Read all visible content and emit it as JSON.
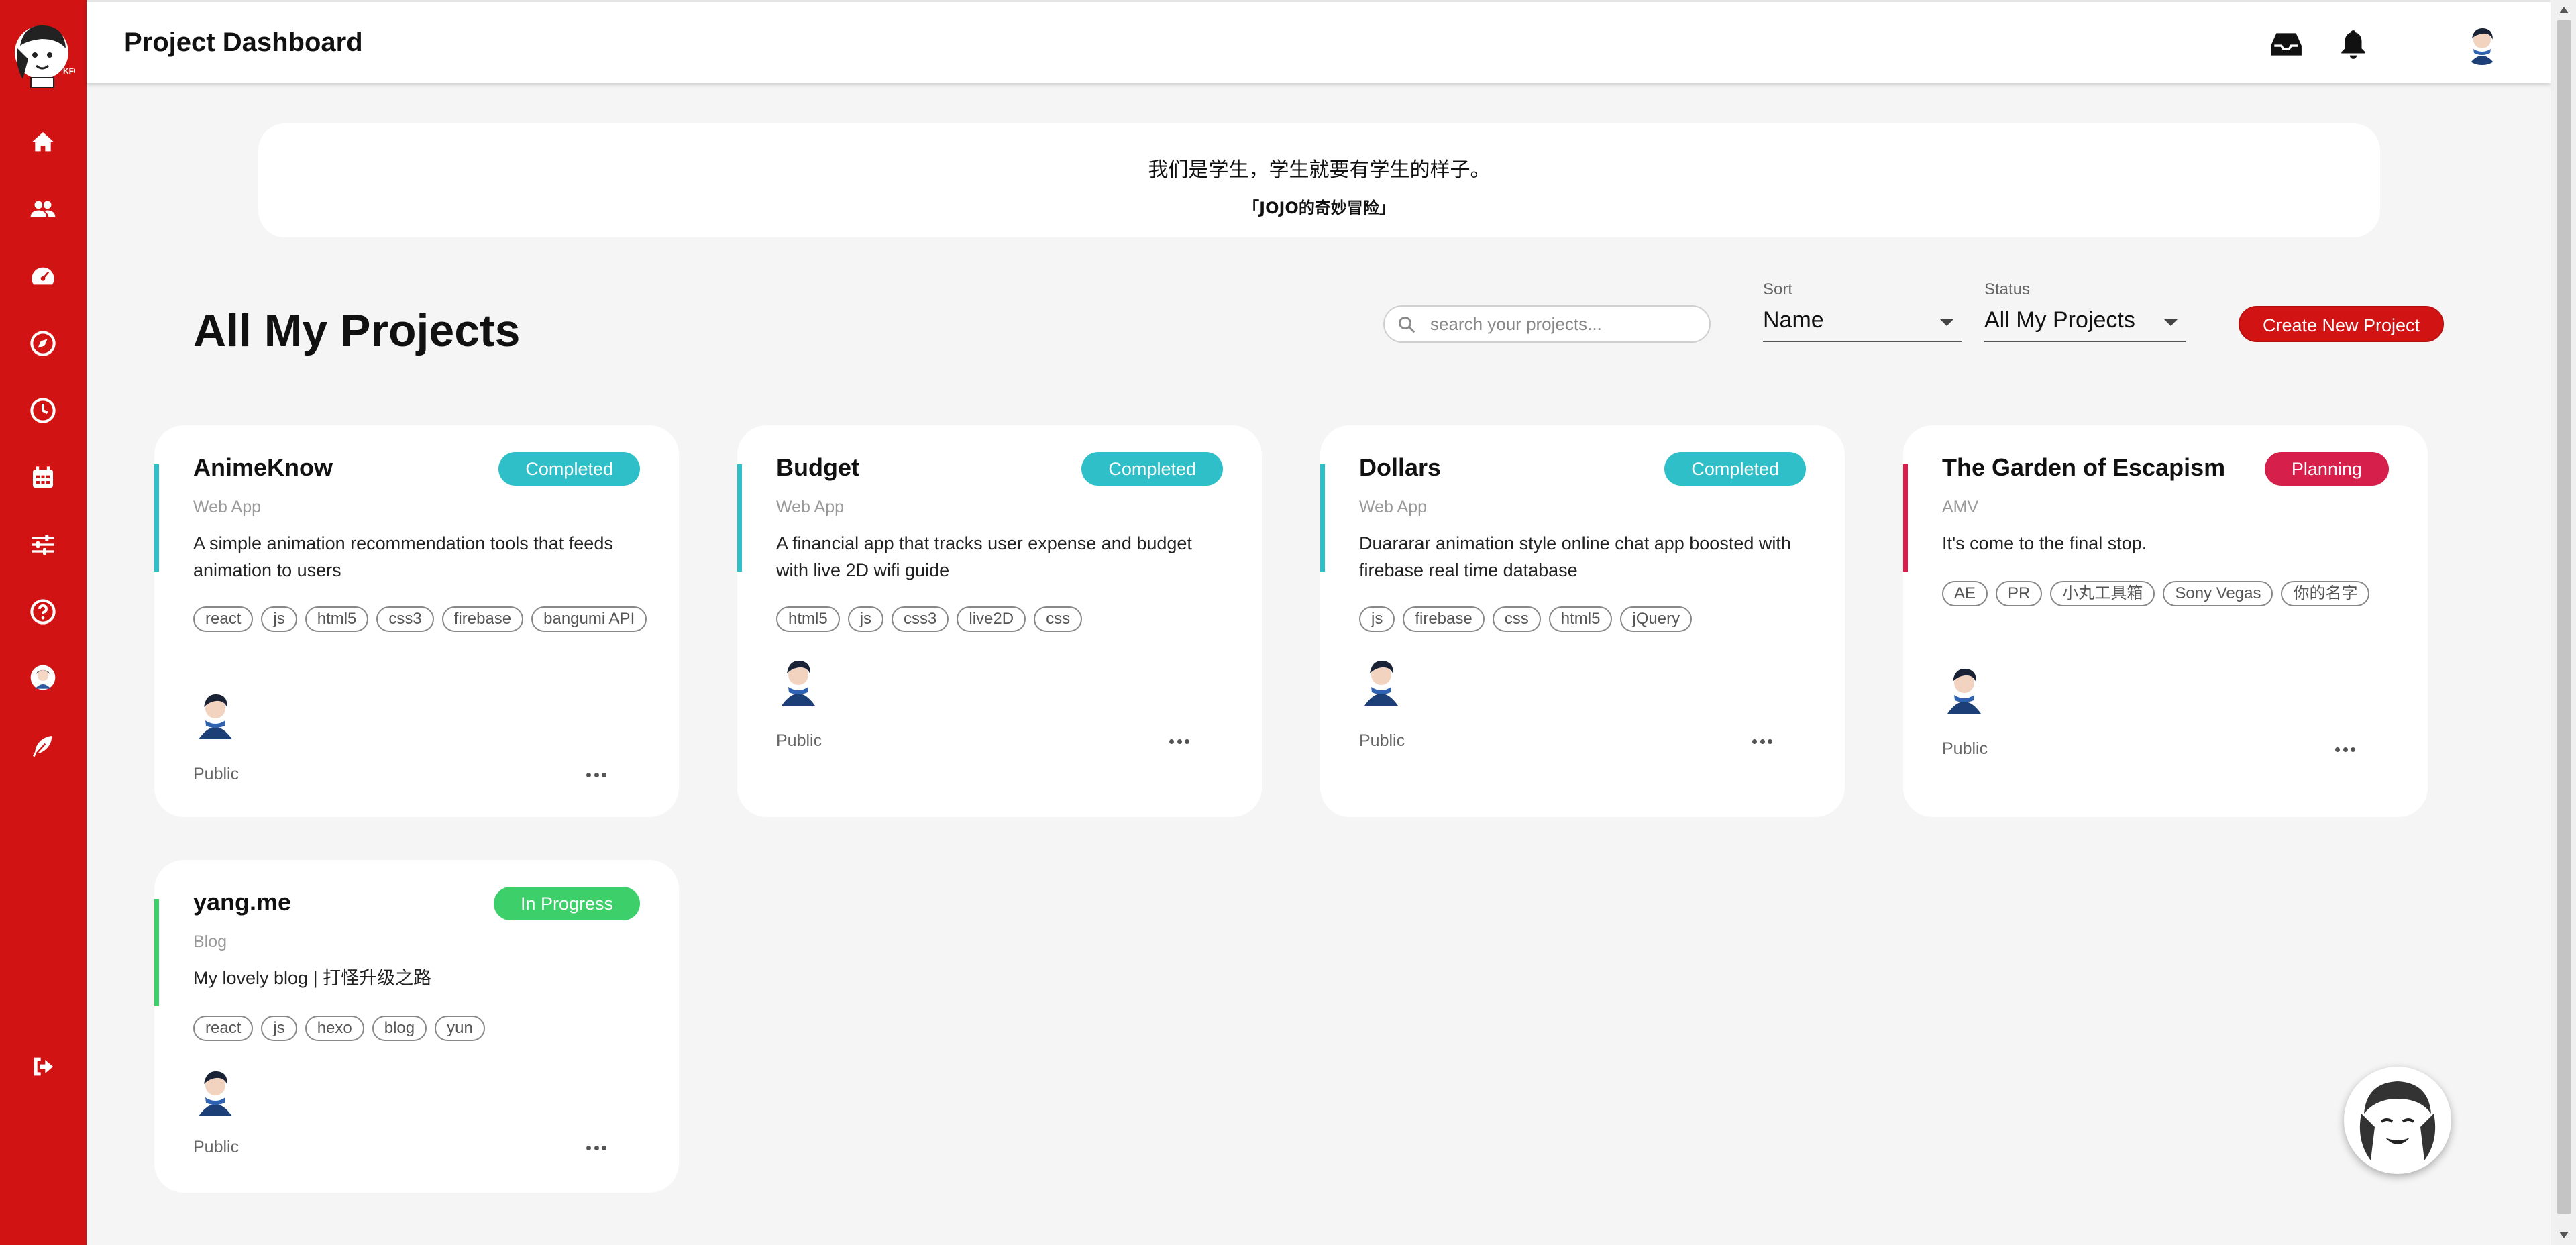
{
  "header": {
    "title": "Project Dashboard",
    "icons": [
      "inbox-icon",
      "bell-icon",
      "user-avatar"
    ]
  },
  "sidebar": {
    "items": [
      {
        "name": "home-icon"
      },
      {
        "name": "users-icon"
      },
      {
        "name": "dashboard-icon"
      },
      {
        "name": "compass-icon"
      },
      {
        "name": "clock-icon"
      },
      {
        "name": "calendar-icon"
      },
      {
        "name": "sliders-icon"
      },
      {
        "name": "help-icon"
      },
      {
        "name": "avatar-icon"
      },
      {
        "name": "feather-icon"
      },
      {
        "name": "logout-icon"
      }
    ]
  },
  "quote": {
    "text": "我们是学生，学生就要有学生的样子。",
    "source": "「JOJO的奇妙冒险」"
  },
  "main": {
    "title": "All My Projects",
    "search_placeholder": "search your projects...",
    "sort": {
      "label": "Sort",
      "value": "Name"
    },
    "status": {
      "label": "Status",
      "value": "All My Projects"
    },
    "create_label": "Create New Project"
  },
  "colors": {
    "brand": "#d21313",
    "completed": "#2ebfc9",
    "planning": "#d61f4a",
    "in_progress": "#3ccf6a"
  },
  "projects": [
    {
      "title": "AnimeKnow",
      "status": "Completed",
      "category": "Web App",
      "description": "A simple animation recommendation tools that feeds animation to users",
      "tags": [
        "react",
        "js",
        "html5",
        "css3",
        "firebase",
        "bangumi API"
      ],
      "visibility": "Public"
    },
    {
      "title": "Budget",
      "status": "Completed",
      "category": "Web App",
      "description": "A financial app that tracks user expense and budget with live 2D wifi guide",
      "tags": [
        "html5",
        "js",
        "css3",
        "live2D",
        "css"
      ],
      "visibility": "Public"
    },
    {
      "title": "Dollars",
      "status": "Completed",
      "category": "Web App",
      "description": "Duararar animation style online chat app boosted with firebase real time database",
      "tags": [
        "js",
        "firebase",
        "css",
        "html5",
        "jQuery"
      ],
      "visibility": "Public"
    },
    {
      "title": "The Garden of Escapism",
      "status": "Planning",
      "category": "AMV",
      "description": "It's come to the final stop.",
      "tags": [
        "AE",
        "PR",
        "小丸工具箱",
        "Sony Vegas",
        "你的名字"
      ],
      "visibility": "Public"
    },
    {
      "title": "yang.me",
      "status": "In Progress",
      "category": "Blog",
      "description": "My lovely blog | 打怪升级之路",
      "tags": [
        "react",
        "js",
        "hexo",
        "blog",
        "yun"
      ],
      "visibility": "Public"
    }
  ]
}
